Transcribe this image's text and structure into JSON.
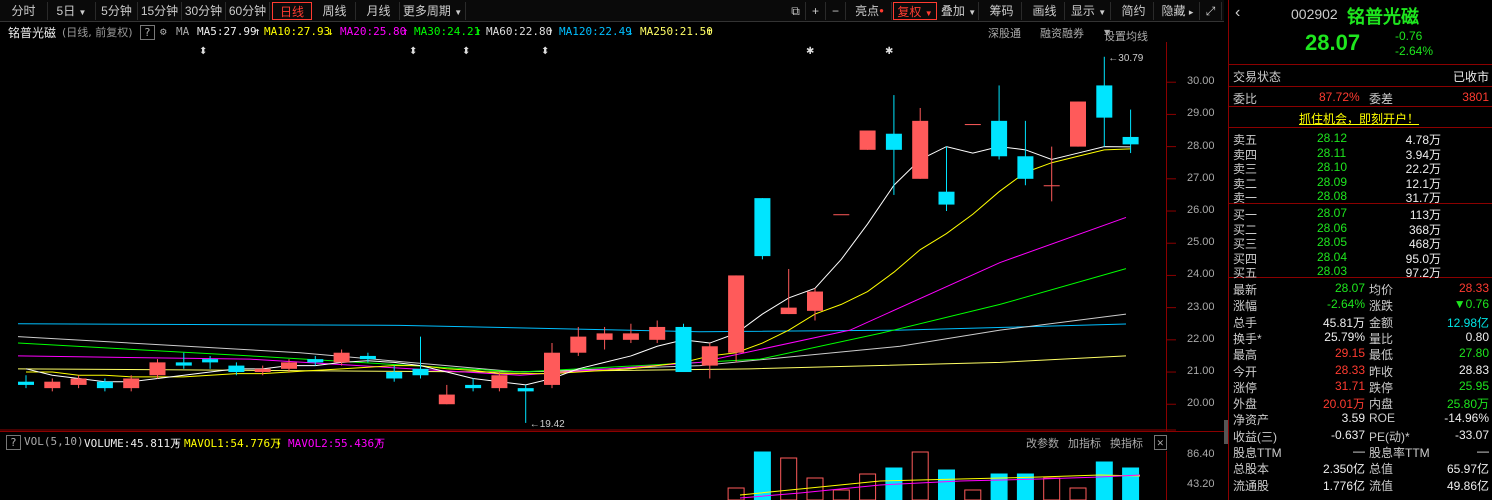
{
  "toolbar": {
    "periods": [
      "分时",
      "5日",
      "5分钟",
      "15分钟",
      "30分钟",
      "60分钟",
      "日线",
      "周线",
      "月线",
      "更多周期"
    ],
    "active_period": "日线",
    "right": [
      "亮点",
      "复权",
      "叠加",
      "筹码",
      "画线",
      "显示",
      "简约",
      "隐藏"
    ],
    "plus": "+",
    "minus": "−"
  },
  "ma_bar": {
    "title": "铭普光磁",
    "subtitle": "(日线, 前复权)",
    "help": "?",
    "ma_label": "MA",
    "ma5": "MA5:27.99",
    "ma10": "MA10:27.93",
    "ma20": "MA20:25.80",
    "ma30": "MA30:24.21",
    "ma60": "MA60:22.80",
    "ma120": "MA120:22.49",
    "ma250": "MA250:21.50",
    "links": [
      "深股通",
      "融资融券",
      "设置均线"
    ]
  },
  "price_axis": [
    "30.00",
    "29.00",
    "28.00",
    "27.00",
    "26.00",
    "25.00",
    "24.00",
    "23.00",
    "22.00",
    "21.00",
    "20.00"
  ],
  "annotations": {
    "high": "30.79",
    "low": "19.42"
  },
  "vol_bar": {
    "help": "?",
    "label": "VOL(5,10)",
    "volume": "VOLUME:45.811万",
    "mavol1": "MAVOL1:54.776万",
    "mavol2": "MAVOL2:55.436万",
    "links": [
      "改参数",
      "加指标",
      "换指标"
    ],
    "axis": [
      "86.40",
      "43.20"
    ]
  },
  "colors": {
    "up": "#ff5a5a",
    "down": "#00e5ff",
    "ma5": "#ffffff",
    "ma10": "#ffff00",
    "ma20": "#ff00ff",
    "ma30": "#00ff00",
    "ma60": "#cccccc",
    "ma120": "#00bfff",
    "ma250": "#ffff66"
  },
  "chart_data": {
    "type": "candlestick",
    "title": "铭普光磁",
    "ylim": [
      19.2,
      31.0
    ],
    "candles": [
      {
        "o": 20.7,
        "c": 20.6,
        "h": 20.9,
        "l": 20.5
      },
      {
        "o": 20.5,
        "c": 20.7,
        "h": 20.8,
        "l": 20.4
      },
      {
        "o": 20.6,
        "c": 20.8,
        "h": 20.9,
        "l": 20.5
      },
      {
        "o": 20.7,
        "c": 20.5,
        "h": 20.8,
        "l": 20.4
      },
      {
        "o": 20.5,
        "c": 20.8,
        "h": 20.9,
        "l": 20.4
      },
      {
        "o": 20.9,
        "c": 21.3,
        "h": 21.4,
        "l": 20.8
      },
      {
        "o": 21.3,
        "c": 21.2,
        "h": 21.6,
        "l": 21.1
      },
      {
        "o": 21.4,
        "c": 21.3,
        "h": 21.5,
        "l": 21.1
      },
      {
        "o": 21.2,
        "c": 21.0,
        "h": 21.3,
        "l": 20.9
      },
      {
        "o": 21.0,
        "c": 21.1,
        "h": 21.2,
        "l": 20.9
      },
      {
        "o": 21.1,
        "c": 21.3,
        "h": 21.4,
        "l": 21.0
      },
      {
        "o": 21.4,
        "c": 21.3,
        "h": 21.5,
        "l": 21.2
      },
      {
        "o": 21.3,
        "c": 21.6,
        "h": 21.7,
        "l": 21.2
      },
      {
        "o": 21.5,
        "c": 21.4,
        "h": 21.6,
        "l": 21.3
      },
      {
        "o": 21.0,
        "c": 20.8,
        "h": 21.2,
        "l": 20.7
      },
      {
        "o": 21.1,
        "c": 20.9,
        "h": 22.1,
        "l": 20.8
      },
      {
        "o": 20.0,
        "c": 20.3,
        "h": 20.6,
        "l": 20.0
      },
      {
        "o": 20.6,
        "c": 20.5,
        "h": 20.8,
        "l": 20.4
      },
      {
        "o": 20.5,
        "c": 20.9,
        "h": 21.0,
        "l": 20.4
      },
      {
        "o": 20.5,
        "c": 20.4,
        "h": 20.6,
        "l": 19.42
      },
      {
        "o": 20.6,
        "c": 21.6,
        "h": 21.9,
        "l": 20.5
      },
      {
        "o": 21.6,
        "c": 22.1,
        "h": 22.4,
        "l": 21.5
      },
      {
        "o": 22.0,
        "c": 22.2,
        "h": 22.4,
        "l": 21.7
      },
      {
        "o": 22.0,
        "c": 22.2,
        "h": 22.5,
        "l": 21.9
      },
      {
        "o": 22.0,
        "c": 22.4,
        "h": 22.6,
        "l": 21.9
      },
      {
        "o": 22.4,
        "c": 21.0,
        "h": 22.5,
        "l": 21.0
      },
      {
        "o": 21.2,
        "c": 21.8,
        "h": 21.9,
        "l": 20.8
      },
      {
        "o": 21.6,
        "c": 24.0,
        "h": 24.0,
        "l": 21.3
      },
      {
        "o": 26.4,
        "c": 24.6,
        "h": 26.4,
        "l": 24.5
      },
      {
        "o": 22.8,
        "c": 23.0,
        "h": 24.2,
        "l": 22.8
      },
      {
        "o": 22.9,
        "c": 23.5,
        "h": 23.6,
        "l": 22.6
      },
      {
        "o": 25.9,
        "c": 25.9,
        "h": 25.9,
        "l": 25.9
      },
      {
        "o": 27.9,
        "c": 28.5,
        "h": 28.5,
        "l": 27.9
      },
      {
        "o": 28.4,
        "c": 27.9,
        "h": 29.6,
        "l": 26.5
      },
      {
        "o": 27.0,
        "c": 28.8,
        "h": 29.2,
        "l": 27.0
      },
      {
        "o": 26.6,
        "c": 26.2,
        "h": 28.0,
        "l": 26.0
      },
      {
        "o": 28.7,
        "c": 28.7,
        "h": 28.7,
        "l": 28.7
      },
      {
        "o": 28.8,
        "c": 27.7,
        "h": 29.9,
        "l": 27.6
      },
      {
        "o": 27.7,
        "c": 27.0,
        "h": 28.8,
        "l": 26.8
      },
      {
        "o": 26.8,
        "c": 26.8,
        "h": 28.0,
        "l": 26.3
      },
      {
        "o": 28.0,
        "c": 29.4,
        "h": 29.4,
        "l": 28.0
      },
      {
        "o": 29.9,
        "c": 28.9,
        "h": 30.79,
        "l": 28.0
      },
      {
        "o": 28.3,
        "c": 28.07,
        "h": 29.15,
        "l": 27.8
      }
    ],
    "ma5": [
      21.1,
      20.9,
      20.8,
      20.7,
      20.7,
      20.8,
      20.9,
      21.0,
      21.1,
      21.1,
      21.2,
      21.2,
      21.3,
      21.35,
      21.3,
      21.2,
      21.0,
      20.8,
      20.7,
      20.6,
      20.8,
      21.1,
      21.3,
      21.5,
      21.8,
      22.0,
      21.9,
      22.2,
      22.8,
      23.3,
      23.6,
      24.5,
      25.6,
      26.8,
      27.6,
      28.0,
      27.8,
      28.0,
      27.9,
      27.6,
      27.8,
      28.0,
      27.99
    ],
    "ma10": [
      21.0,
      21.0,
      20.9,
      20.9,
      20.85,
      20.85,
      20.85,
      20.9,
      20.95,
      20.95,
      21.0,
      21.05,
      21.1,
      21.15,
      21.2,
      21.2,
      21.1,
      21.05,
      20.95,
      20.95,
      20.95,
      21.0,
      21.05,
      21.1,
      21.2,
      21.3,
      21.5,
      21.6,
      21.9,
      22.3,
      22.8,
      23.1,
      23.5,
      24.1,
      24.8,
      25.3,
      25.9,
      26.6,
      27.2,
      27.5,
      27.7,
      27.9,
      27.93
    ],
    "xlabel": "",
    "ylabel": ""
  },
  "quote": {
    "code": "002902",
    "name": "铭普光磁",
    "price": "28.07",
    "change": "-0.76",
    "change_pct": "-2.64%",
    "status_label": "交易状态",
    "status": "已收市",
    "webi_label": "委比",
    "webi": "87.72%",
    "weicha_label": "委差",
    "weicha": "3801",
    "promo": "抓住机会，即刻开户！",
    "asks": [
      {
        "label": "卖五",
        "price": "28.12",
        "vol": "4.78万"
      },
      {
        "label": "卖四",
        "price": "28.11",
        "vol": "3.94万"
      },
      {
        "label": "卖三",
        "price": "28.10",
        "vol": "22.2万"
      },
      {
        "label": "卖二",
        "price": "28.09",
        "vol": "12.1万"
      },
      {
        "label": "卖一",
        "price": "28.08",
        "vol": "31.7万"
      }
    ],
    "bids": [
      {
        "label": "买一",
        "price": "28.07",
        "vol": "113万"
      },
      {
        "label": "买二",
        "price": "28.06",
        "vol": "368万"
      },
      {
        "label": "买三",
        "price": "28.05",
        "vol": "468万"
      },
      {
        "label": "买四",
        "price": "28.04",
        "vol": "95.0万"
      },
      {
        "label": "买五",
        "price": "28.03",
        "vol": "97.2万"
      }
    ],
    "stats": [
      {
        "l1": "最新",
        "v1": "28.07",
        "c1": "grn",
        "l2": "均价",
        "v2": "28.33",
        "c2": "red"
      },
      {
        "l1": "涨幅",
        "v1": "-2.64%",
        "c1": "grn",
        "l2": "涨跌",
        "v2": "▼0.76",
        "c2": "grn"
      },
      {
        "l1": "总手",
        "v1": "45.81万",
        "c1": "white",
        "l2": "金额",
        "v2": "12.98亿",
        "c2": "green"
      },
      {
        "l1": "换手*",
        "v1": "25.79%",
        "c1": "white",
        "l2": "量比",
        "v2": "0.80",
        "c2": "white"
      },
      {
        "l1": "最高",
        "v1": "29.15",
        "c1": "red",
        "l2": "最低",
        "v2": "27.80",
        "c2": "grn"
      },
      {
        "l1": "今开",
        "v1": "28.33",
        "c1": "red",
        "l2": "昨收",
        "v2": "28.83",
        "c2": "white"
      },
      {
        "l1": "涨停",
        "v1": "31.71",
        "c1": "red",
        "l2": "跌停",
        "v2": "25.95",
        "c2": "grn"
      },
      {
        "l1": "外盘",
        "v1": "20.01万",
        "c1": "red",
        "l2": "内盘",
        "v2": "25.80万",
        "c2": "grn"
      },
      {
        "l1": "净资产",
        "v1": "3.59",
        "c1": "white",
        "l2": "ROE",
        "v2": "-14.96%",
        "c2": "white"
      },
      {
        "l1": "收益(三)",
        "v1": "-0.637",
        "c1": "white",
        "l2": "PE(动)*",
        "v2": "-33.07",
        "c2": "white"
      },
      {
        "l1": "股息TTM",
        "v1": "—",
        "c1": "white",
        "l2": "股息率TTM",
        "v2": "—",
        "c2": "white"
      },
      {
        "l1": "总股本",
        "v1": "2.350亿",
        "c1": "white",
        "l2": "总值",
        "v2": "65.97亿",
        "c2": "white"
      },
      {
        "l1": "流通股",
        "v1": "1.776亿",
        "c1": "white",
        "l2": "流值",
        "v2": "49.86亿",
        "c2": "white"
      }
    ]
  }
}
